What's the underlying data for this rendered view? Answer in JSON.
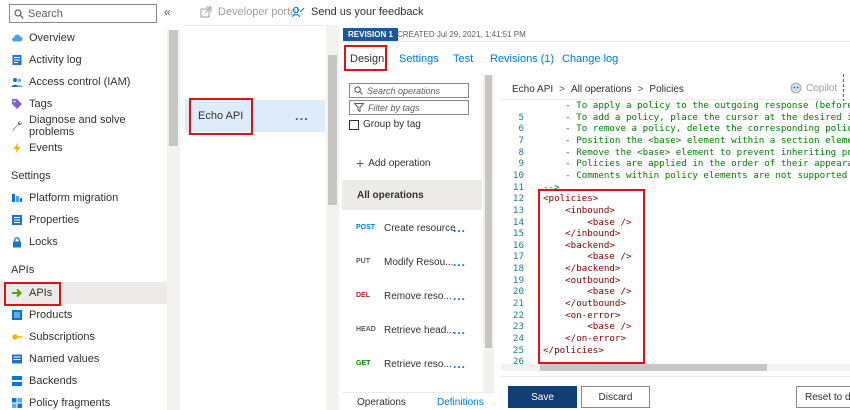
{
  "sidebar": {
    "search_placeholder": "Search",
    "collapse_glyph": "«",
    "items_top": [
      {
        "label": "Overview",
        "icon": "cloud-icon"
      },
      {
        "label": "Activity log",
        "icon": "activity-log-icon"
      },
      {
        "label": "Access control (IAM)",
        "icon": "people-icon"
      },
      {
        "label": "Tags",
        "icon": "tag-icon"
      },
      {
        "label": "Diagnose and solve problems",
        "icon": "wrench-icon"
      },
      {
        "label": "Events",
        "icon": "bolt-icon"
      }
    ],
    "settings_heading": "Settings",
    "items_settings": [
      {
        "label": "Platform migration",
        "icon": "migration-icon"
      },
      {
        "label": "Properties",
        "icon": "properties-icon"
      },
      {
        "label": "Locks",
        "icon": "lock-icon"
      }
    ],
    "apis_heading": "APIs",
    "items_apis": [
      {
        "label": "APIs",
        "icon": "api-arrow-icon",
        "active": true
      },
      {
        "label": "Products",
        "icon": "products-icon"
      },
      {
        "label": "Subscriptions",
        "icon": "key-icon"
      },
      {
        "label": "Named values",
        "icon": "named-values-icon"
      },
      {
        "label": "Backends",
        "icon": "backends-icon"
      },
      {
        "label": "Policy fragments",
        "icon": "policy-fragments-icon"
      }
    ]
  },
  "topbar": {
    "developer_portal": "Developer portal",
    "feedback": "Send us your feedback"
  },
  "api_list": {
    "selected": "Echo API",
    "more": "..."
  },
  "revision": {
    "badge": "REVISION 1",
    "created": "CREATED Jul 29, 2021, 1:41:51 PM"
  },
  "tabs": [
    "Design",
    "Settings",
    "Test",
    "Revisions (1)",
    "Change log"
  ],
  "operations": {
    "search_placeholder": "Search operations",
    "filter_placeholder": "Filter by tags",
    "group_by_label": "Group by tag",
    "add_label": "Add operation",
    "all_label": "All operations",
    "items": [
      {
        "verb": "POST",
        "name": "Create resource",
        "color": "#0078d4"
      },
      {
        "verb": "PUT",
        "name": "Modify Resou...",
        "color": "#605e5c"
      },
      {
        "verb": "DEL",
        "name": "Remove reso...",
        "color": "#a4262c"
      },
      {
        "verb": "HEAD",
        "name": "Retrieve head...",
        "color": "#605e5c"
      },
      {
        "verb": "GET",
        "name": "Retrieve reso...",
        "color": "#107c10"
      }
    ],
    "footer_left": "Operations",
    "footer_right": "Definitions",
    "more": "..."
  },
  "editor": {
    "breadcrumb": [
      "Echo API",
      "All operations",
      "Policies"
    ],
    "crumb_sep": ">",
    "copilot_label": "Copilot",
    "lines": [
      {
        "n": "",
        "t": "    - To apply a policy to the outgoing response (before r",
        "cls": "cm"
      },
      {
        "n": "5",
        "t": "    - To add a policy, place the cursor at the desired ins",
        "cls": "cm"
      },
      {
        "n": "6",
        "t": "    - To remove a policy, delete the corresponding policy",
        "cls": "cm"
      },
      {
        "n": "7",
        "t": "    - Position the <base> element within a section element",
        "cls": "cm"
      },
      {
        "n": "8",
        "t": "    - Remove the <base> element to prevent inheriting poli",
        "cls": "cm"
      },
      {
        "n": "9",
        "t": "    - Policies are applied in the order of their appearanc",
        "cls": "cm"
      },
      {
        "n": "10",
        "t": "    - Comments within policy elements are not supported an",
        "cls": "cm"
      },
      {
        "n": "11",
        "t": "-->",
        "cls": "cm"
      },
      {
        "n": "12",
        "t": "<policies>",
        "cls": "tag"
      },
      {
        "n": "13",
        "t": "    <inbound>",
        "cls": "tag"
      },
      {
        "n": "14",
        "t": "        <base />",
        "cls": "tag"
      },
      {
        "n": "15",
        "t": "    </inbound>",
        "cls": "tag"
      },
      {
        "n": "16",
        "t": "    <backend>",
        "cls": "tag"
      },
      {
        "n": "17",
        "t": "        <base />",
        "cls": "tag"
      },
      {
        "n": "18",
        "t": "    </backend>",
        "cls": "tag"
      },
      {
        "n": "19",
        "t": "    <outbound>",
        "cls": "tag"
      },
      {
        "n": "20",
        "t": "        <base />",
        "cls": "tag"
      },
      {
        "n": "21",
        "t": "    </outbound>",
        "cls": "tag"
      },
      {
        "n": "22",
        "t": "    <on-error>",
        "cls": "tag"
      },
      {
        "n": "23",
        "t": "        <base />",
        "cls": "tag"
      },
      {
        "n": "24",
        "t": "    </on-error>",
        "cls": "tag"
      },
      {
        "n": "25",
        "t": "</policies>",
        "cls": "tag"
      },
      {
        "n": "26",
        "t": "",
        "cls": "tag"
      }
    ]
  },
  "actions": {
    "save": "Save",
    "discard": "Discard",
    "reset": "Reset to de"
  },
  "colors": {
    "accent": "#0078d4",
    "highlight": "#d8131a",
    "save_button": "#0f3f76",
    "revision_badge": "#1e5799"
  }
}
